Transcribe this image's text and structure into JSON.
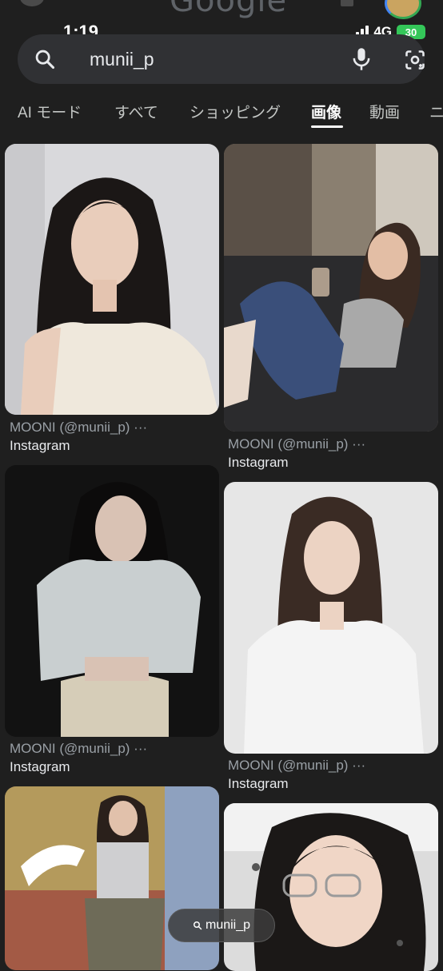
{
  "status_bar": {
    "time": "1:19",
    "network": "4G",
    "battery": "30"
  },
  "search": {
    "query": "munii_p"
  },
  "tabs": [
    {
      "label": "AI モード"
    },
    {
      "label": "すべて"
    },
    {
      "label": "ショッピング"
    },
    {
      "label": "画像",
      "active": true
    },
    {
      "label": "動画"
    },
    {
      "label": "ニ"
    }
  ],
  "results": [
    {
      "title": "MOONI (@munii_p) ···",
      "source": "Instagram"
    },
    {
      "title": "MOONI (@munii_p) ···",
      "source": "Instagram"
    },
    {
      "title": "MOONI (@munii_p) ···",
      "source": "Instagram"
    },
    {
      "title": "MOONI (@munii_p) ···",
      "source": "Instagram"
    }
  ],
  "floating_chip": {
    "label": "munii_p"
  },
  "colors": {
    "background": "#1f1f1f",
    "search_bar": "#303134",
    "battery": "#34c759"
  },
  "ghost_header": {
    "logo": "Google"
  }
}
